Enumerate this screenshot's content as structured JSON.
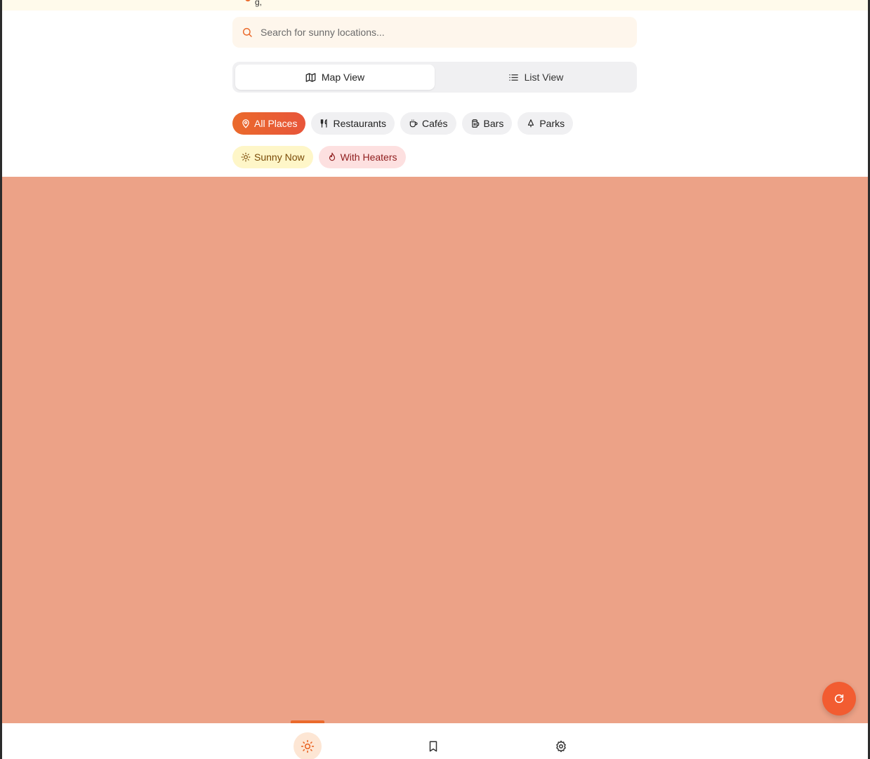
{
  "top_strip": {
    "partial_text": "g,"
  },
  "search": {
    "placeholder": "Search for sunny locations...",
    "value": "",
    "icon": "search-icon"
  },
  "view_toggle": {
    "map_label": "Map View",
    "list_label": "List View",
    "selected": "Map View"
  },
  "category_filters": [
    {
      "label": "All Places",
      "icon": "map-pin-icon",
      "active": true
    },
    {
      "label": "Restaurants",
      "icon": "utensils-icon",
      "active": false
    },
    {
      "label": "Cafés",
      "icon": "coffee-icon",
      "active": false
    },
    {
      "label": "Bars",
      "icon": "beer-icon",
      "active": false
    },
    {
      "label": "Parks",
      "icon": "tree-icon",
      "active": false
    }
  ],
  "condition_filters": [
    {
      "label": "Sunny Now",
      "icon": "sun-icon"
    },
    {
      "label": "With Heaters",
      "icon": "flame-icon"
    }
  ],
  "fab": {
    "icon": "refresh-icon"
  },
  "bottom_nav": [
    {
      "name": "sun",
      "icon": "sun-icon",
      "active": true
    },
    {
      "name": "bookmark",
      "icon": "bookmark-icon",
      "active": false
    },
    {
      "name": "settings",
      "icon": "gear-icon",
      "active": false
    }
  ],
  "colors": {
    "accent": "#ea6a2c",
    "map_placeholder": "#eca287",
    "fab": "#f25c31",
    "sunny_chip_bg": "#fef6c8",
    "heater_chip_bg": "#fde0e0"
  }
}
